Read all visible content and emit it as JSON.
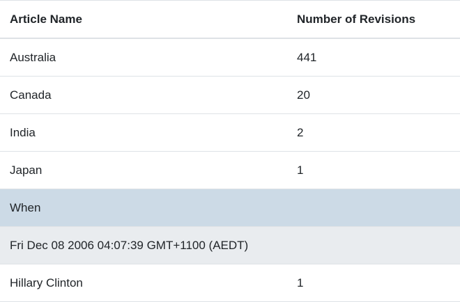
{
  "table": {
    "headers": [
      "Article Name",
      "Number of Revisions"
    ],
    "rows": [
      {
        "article": "Australia",
        "revisions": "441"
      },
      {
        "article": "Canada",
        "revisions": "20"
      },
      {
        "article": "India",
        "revisions": "2"
      },
      {
        "article": "Japan",
        "revisions": "1"
      }
    ],
    "group_label": "When",
    "group_date": "Fri Dec 08 2006 04:07:39 GMT+1100 (AEDT)",
    "group_rows": [
      {
        "article": "Hillary Clinton",
        "revisions": "1"
      }
    ]
  },
  "colors": {
    "group_header_bg": "#ccdae6",
    "group_date_bg": "#e9ecef",
    "border": "#dee2e6",
    "text": "#212529"
  }
}
